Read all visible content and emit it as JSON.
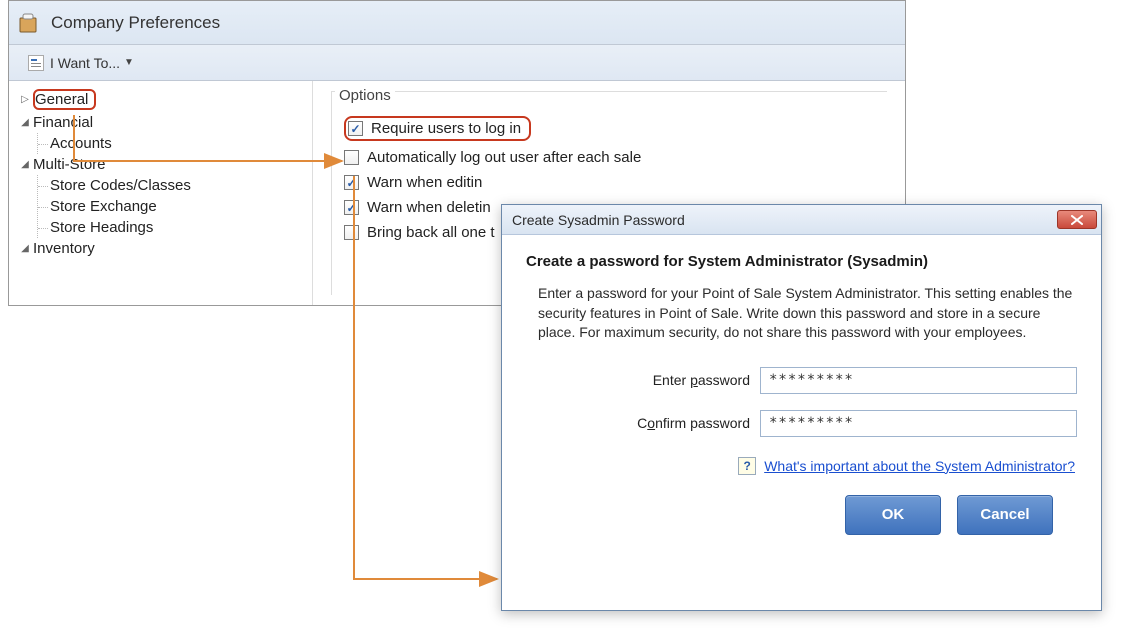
{
  "prefs": {
    "title": "Company Preferences",
    "want_to": "I Want To...",
    "tree": {
      "general": "General",
      "financial": "Financial",
      "accounts": "Accounts",
      "multistore": "Multi-Store",
      "storecodes": "Store Codes/Classes",
      "storeexchange": "Store Exchange",
      "storeheadings": "Store Headings",
      "inventory": "Inventory"
    },
    "options": {
      "group_label": "Options",
      "require_login": "Require users to log in",
      "auto_logout": "Automatically log out user after each sale",
      "warn_edit": "Warn when editin",
      "warn_delete": "Warn when deletin",
      "bring_back": "Bring back all one t"
    }
  },
  "dialog": {
    "title": "Create Sysadmin Password",
    "heading": "Create a password for System Administrator (Sysadmin)",
    "description": "Enter a password for your Point of Sale System Administrator. This setting enables the security features in Point of Sale.  Write down this password and store in a secure place. For maximum security, do not share this password with your employees.",
    "enter_label_pre": "Enter ",
    "enter_label_u": "p",
    "enter_label_post": "assword",
    "confirm_label_pre": "C",
    "confirm_label_u": "o",
    "confirm_label_post": "nfirm password",
    "password_value": "*********",
    "confirm_value": "*********",
    "help_text": "What's important about the System Administrator?",
    "ok": "OK",
    "cancel": "Cancel"
  }
}
